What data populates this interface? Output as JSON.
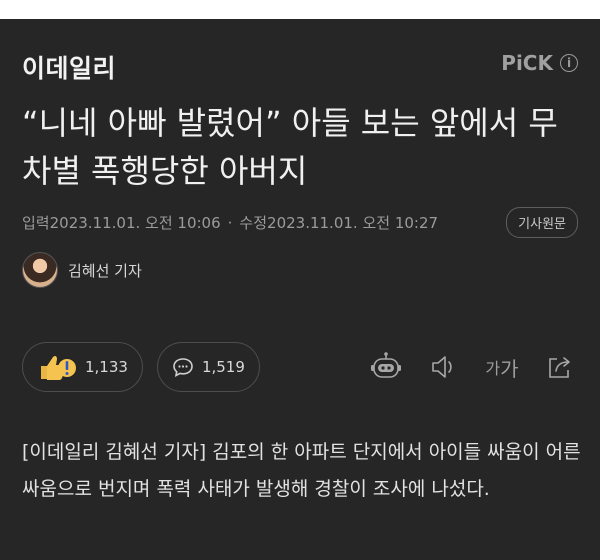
{
  "header": {
    "logo": "이데일리",
    "pick_label": "PiCK",
    "info_icon": "info-icon"
  },
  "article": {
    "title": "“니네 아빠 발렸어” 아들 보는 앞에서 무차별 폭행당한 아버지",
    "published_label": "입력",
    "published": "2023.11.01. 오전 10:06",
    "modified_label": "수정",
    "modified": "2023.11.01. 오전 10:27",
    "original_button": "기사원문",
    "author": "김혜선 기자",
    "body": "[이데일리 김혜선 기자] 김포의 한 아파트 단지에서 아이들 싸움이 어른 싸움으로 번지며 폭력 사태가 발생해 경찰이 조사에 나섰다."
  },
  "reactions": {
    "like_count": "1,133",
    "comment_count": "1,519"
  },
  "toolbar": {
    "font_small": "가",
    "font_large": "가"
  },
  "colors": {
    "background": "#262627",
    "text": "#e8e8e8",
    "muted": "#9b9b9b",
    "border": "#4d4d4d"
  }
}
